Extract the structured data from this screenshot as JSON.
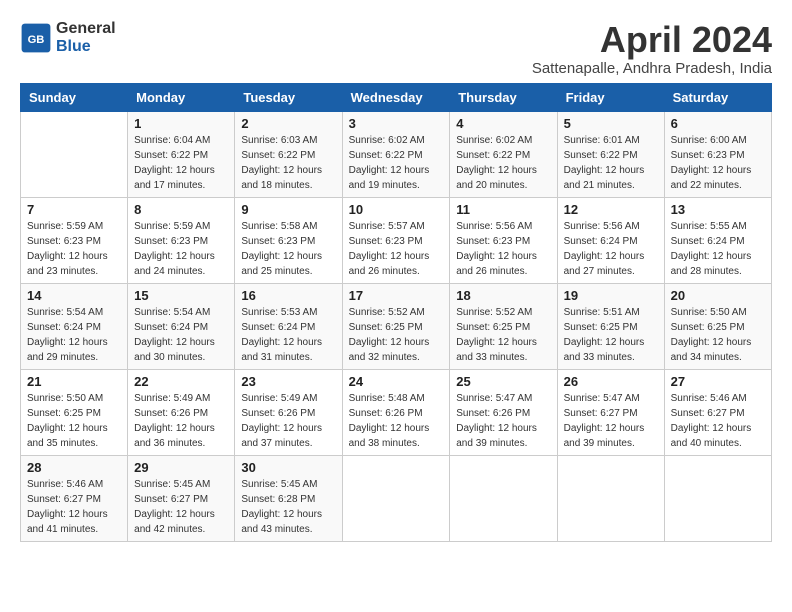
{
  "header": {
    "logo_line1": "General",
    "logo_line2": "Blue",
    "month_title": "April 2024",
    "subtitle": "Sattenapalle, Andhra Pradesh, India"
  },
  "days_of_week": [
    "Sunday",
    "Monday",
    "Tuesday",
    "Wednesday",
    "Thursday",
    "Friday",
    "Saturday"
  ],
  "weeks": [
    [
      {
        "day": "",
        "info": ""
      },
      {
        "day": "1",
        "info": "Sunrise: 6:04 AM\nSunset: 6:22 PM\nDaylight: 12 hours\nand 17 minutes."
      },
      {
        "day": "2",
        "info": "Sunrise: 6:03 AM\nSunset: 6:22 PM\nDaylight: 12 hours\nand 18 minutes."
      },
      {
        "day": "3",
        "info": "Sunrise: 6:02 AM\nSunset: 6:22 PM\nDaylight: 12 hours\nand 19 minutes."
      },
      {
        "day": "4",
        "info": "Sunrise: 6:02 AM\nSunset: 6:22 PM\nDaylight: 12 hours\nand 20 minutes."
      },
      {
        "day": "5",
        "info": "Sunrise: 6:01 AM\nSunset: 6:22 PM\nDaylight: 12 hours\nand 21 minutes."
      },
      {
        "day": "6",
        "info": "Sunrise: 6:00 AM\nSunset: 6:23 PM\nDaylight: 12 hours\nand 22 minutes."
      }
    ],
    [
      {
        "day": "7",
        "info": "Sunrise: 5:59 AM\nSunset: 6:23 PM\nDaylight: 12 hours\nand 23 minutes."
      },
      {
        "day": "8",
        "info": "Sunrise: 5:59 AM\nSunset: 6:23 PM\nDaylight: 12 hours\nand 24 minutes."
      },
      {
        "day": "9",
        "info": "Sunrise: 5:58 AM\nSunset: 6:23 PM\nDaylight: 12 hours\nand 25 minutes."
      },
      {
        "day": "10",
        "info": "Sunrise: 5:57 AM\nSunset: 6:23 PM\nDaylight: 12 hours\nand 26 minutes."
      },
      {
        "day": "11",
        "info": "Sunrise: 5:56 AM\nSunset: 6:23 PM\nDaylight: 12 hours\nand 26 minutes."
      },
      {
        "day": "12",
        "info": "Sunrise: 5:56 AM\nSunset: 6:24 PM\nDaylight: 12 hours\nand 27 minutes."
      },
      {
        "day": "13",
        "info": "Sunrise: 5:55 AM\nSunset: 6:24 PM\nDaylight: 12 hours\nand 28 minutes."
      }
    ],
    [
      {
        "day": "14",
        "info": "Sunrise: 5:54 AM\nSunset: 6:24 PM\nDaylight: 12 hours\nand 29 minutes."
      },
      {
        "day": "15",
        "info": "Sunrise: 5:54 AM\nSunset: 6:24 PM\nDaylight: 12 hours\nand 30 minutes."
      },
      {
        "day": "16",
        "info": "Sunrise: 5:53 AM\nSunset: 6:24 PM\nDaylight: 12 hours\nand 31 minutes."
      },
      {
        "day": "17",
        "info": "Sunrise: 5:52 AM\nSunset: 6:25 PM\nDaylight: 12 hours\nand 32 minutes."
      },
      {
        "day": "18",
        "info": "Sunrise: 5:52 AM\nSunset: 6:25 PM\nDaylight: 12 hours\nand 33 minutes."
      },
      {
        "day": "19",
        "info": "Sunrise: 5:51 AM\nSunset: 6:25 PM\nDaylight: 12 hours\nand 33 minutes."
      },
      {
        "day": "20",
        "info": "Sunrise: 5:50 AM\nSunset: 6:25 PM\nDaylight: 12 hours\nand 34 minutes."
      }
    ],
    [
      {
        "day": "21",
        "info": "Sunrise: 5:50 AM\nSunset: 6:25 PM\nDaylight: 12 hours\nand 35 minutes."
      },
      {
        "day": "22",
        "info": "Sunrise: 5:49 AM\nSunset: 6:26 PM\nDaylight: 12 hours\nand 36 minutes."
      },
      {
        "day": "23",
        "info": "Sunrise: 5:49 AM\nSunset: 6:26 PM\nDaylight: 12 hours\nand 37 minutes."
      },
      {
        "day": "24",
        "info": "Sunrise: 5:48 AM\nSunset: 6:26 PM\nDaylight: 12 hours\nand 38 minutes."
      },
      {
        "day": "25",
        "info": "Sunrise: 5:47 AM\nSunset: 6:26 PM\nDaylight: 12 hours\nand 39 minutes."
      },
      {
        "day": "26",
        "info": "Sunrise: 5:47 AM\nSunset: 6:27 PM\nDaylight: 12 hours\nand 39 minutes."
      },
      {
        "day": "27",
        "info": "Sunrise: 5:46 AM\nSunset: 6:27 PM\nDaylight: 12 hours\nand 40 minutes."
      }
    ],
    [
      {
        "day": "28",
        "info": "Sunrise: 5:46 AM\nSunset: 6:27 PM\nDaylight: 12 hours\nand 41 minutes."
      },
      {
        "day": "29",
        "info": "Sunrise: 5:45 AM\nSunset: 6:27 PM\nDaylight: 12 hours\nand 42 minutes."
      },
      {
        "day": "30",
        "info": "Sunrise: 5:45 AM\nSunset: 6:28 PM\nDaylight: 12 hours\nand 43 minutes."
      },
      {
        "day": "",
        "info": ""
      },
      {
        "day": "",
        "info": ""
      },
      {
        "day": "",
        "info": ""
      },
      {
        "day": "",
        "info": ""
      }
    ]
  ]
}
